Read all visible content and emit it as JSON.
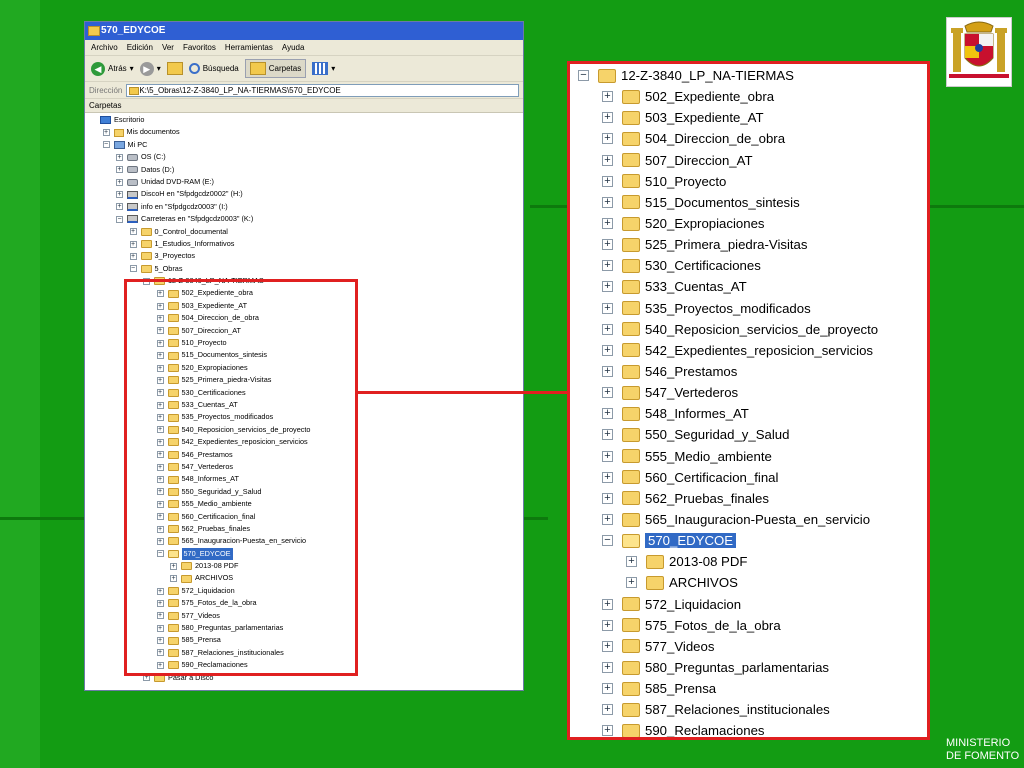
{
  "window": {
    "title": "570_EDYCOE",
    "menu": [
      "Archivo",
      "Edición",
      "Ver",
      "Favoritos",
      "Herramientas",
      "Ayuda"
    ],
    "toolbar": {
      "back": "Atrás",
      "search": "Búsqueda",
      "folders": "Carpetas"
    },
    "address_label": "Dirección",
    "address_value": "K:\\5_Obras\\12-Z-3840_LP_NA-TIERMAS\\570_EDYCOE",
    "folders_pane_title": "Carpetas"
  },
  "tree": [
    {
      "label": "Escritorio",
      "level": 0,
      "icon": "desktop-icon",
      "toggle": "none"
    },
    {
      "label": "Mis documentos",
      "level": 1,
      "icon": "documents-icon",
      "toggle": "plus"
    },
    {
      "label": "Mi PC",
      "level": 1,
      "icon": "computer-icon",
      "toggle": "minus"
    },
    {
      "label": "OS (C:)",
      "level": 2,
      "icon": "drive-icon",
      "toggle": "plus"
    },
    {
      "label": "Datos (D:)",
      "level": 2,
      "icon": "drive-icon",
      "toggle": "plus"
    },
    {
      "label": "Unidad DVD-RAM (E:)",
      "level": 2,
      "icon": "dvd-drive-icon",
      "toggle": "plus"
    },
    {
      "label": "DiscoH en \"Sfpdgcdz0002\" (H:)",
      "level": 2,
      "icon": "network-drive-icon",
      "toggle": "plus"
    },
    {
      "label": "info en \"Sfpdgcdz0003\" (I:)",
      "level": 2,
      "icon": "network-drive-icon",
      "toggle": "plus"
    },
    {
      "label": "Carreteras en \"Sfpdgcdz0003\" (K:)",
      "level": 2,
      "icon": "network-drive-icon",
      "toggle": "minus"
    },
    {
      "label": "0_Control_documental",
      "level": 3,
      "icon": "folder-icon",
      "toggle": "plus"
    },
    {
      "label": "1_Estudios_Informativos",
      "level": 3,
      "icon": "folder-icon",
      "toggle": "plus"
    },
    {
      "label": "3_Proyectos",
      "level": 3,
      "icon": "folder-icon",
      "toggle": "plus"
    },
    {
      "label": "5_Obras",
      "level": 3,
      "icon": "folder-icon",
      "toggle": "minus"
    },
    {
      "label": "12-Z-3840_LP_NA-TIERMAS",
      "level": 4,
      "icon": "folder-icon",
      "toggle": "minus"
    },
    {
      "label": "502_Expediente_obra",
      "level": 5,
      "icon": "folder-icon",
      "toggle": "plus"
    },
    {
      "label": "503_Expediente_AT",
      "level": 5,
      "icon": "folder-icon",
      "toggle": "plus"
    },
    {
      "label": "504_Direccion_de_obra",
      "level": 5,
      "icon": "folder-icon",
      "toggle": "plus"
    },
    {
      "label": "507_Direccion_AT",
      "level": 5,
      "icon": "folder-icon",
      "toggle": "plus"
    },
    {
      "label": "510_Proyecto",
      "level": 5,
      "icon": "folder-icon",
      "toggle": "plus"
    },
    {
      "label": "515_Documentos_sintesis",
      "level": 5,
      "icon": "folder-icon",
      "toggle": "plus"
    },
    {
      "label": "520_Expropiaciones",
      "level": 5,
      "icon": "folder-icon",
      "toggle": "plus"
    },
    {
      "label": "525_Primera_piedra-Visitas",
      "level": 5,
      "icon": "folder-icon",
      "toggle": "plus"
    },
    {
      "label": "530_Certificaciones",
      "level": 5,
      "icon": "folder-icon",
      "toggle": "plus"
    },
    {
      "label": "533_Cuentas_AT",
      "level": 5,
      "icon": "folder-icon",
      "toggle": "plus"
    },
    {
      "label": "535_Proyectos_modificados",
      "level": 5,
      "icon": "folder-icon",
      "toggle": "plus"
    },
    {
      "label": "540_Reposicion_servicios_de_proyecto",
      "level": 5,
      "icon": "folder-icon",
      "toggle": "plus"
    },
    {
      "label": "542_Expedientes_reposicion_servicios",
      "level": 5,
      "icon": "folder-icon",
      "toggle": "plus"
    },
    {
      "label": "546_Prestamos",
      "level": 5,
      "icon": "folder-icon",
      "toggle": "plus"
    },
    {
      "label": "547_Vertederos",
      "level": 5,
      "icon": "folder-icon",
      "toggle": "plus"
    },
    {
      "label": "548_Informes_AT",
      "level": 5,
      "icon": "folder-icon",
      "toggle": "plus"
    },
    {
      "label": "550_Seguridad_y_Salud",
      "level": 5,
      "icon": "folder-icon",
      "toggle": "plus"
    },
    {
      "label": "555_Medio_ambiente",
      "level": 5,
      "icon": "folder-icon",
      "toggle": "plus"
    },
    {
      "label": "560_Certificacion_final",
      "level": 5,
      "icon": "folder-icon",
      "toggle": "plus"
    },
    {
      "label": "562_Pruebas_finales",
      "level": 5,
      "icon": "folder-icon",
      "toggle": "plus"
    },
    {
      "label": "565_Inauguracion-Puesta_en_servicio",
      "level": 5,
      "icon": "folder-icon",
      "toggle": "plus"
    },
    {
      "label": "570_EDYCOE",
      "level": 5,
      "icon": "folder-open-icon",
      "toggle": "minus",
      "selected": true
    },
    {
      "label": "2013-08 PDF",
      "level": 6,
      "icon": "folder-icon",
      "toggle": "plus"
    },
    {
      "label": "ARCHIVOS",
      "level": 6,
      "icon": "folder-icon",
      "toggle": "plus"
    },
    {
      "label": "572_Liquidacion",
      "level": 5,
      "icon": "folder-icon",
      "toggle": "plus"
    },
    {
      "label": "575_Fotos_de_la_obra",
      "level": 5,
      "icon": "folder-icon",
      "toggle": "plus"
    },
    {
      "label": "577_Videos",
      "level": 5,
      "icon": "folder-icon",
      "toggle": "plus"
    },
    {
      "label": "580_Preguntas_parlamentarias",
      "level": 5,
      "icon": "folder-icon",
      "toggle": "plus"
    },
    {
      "label": "585_Prensa",
      "level": 5,
      "icon": "folder-icon",
      "toggle": "plus"
    },
    {
      "label": "587_Relaciones_institucionales",
      "level": 5,
      "icon": "folder-icon",
      "toggle": "plus"
    },
    {
      "label": "590_Reclamaciones",
      "level": 5,
      "icon": "folder-icon",
      "toggle": "plus"
    },
    {
      "label": "Pasar a Disco",
      "level": 4,
      "icon": "folder-icon",
      "toggle": "plus"
    }
  ],
  "zoom_tree": [
    {
      "label": "12-Z-3840_LP_NA-TIERMAS",
      "level": 0,
      "toggle": "minus"
    },
    {
      "label": "502_Expediente_obra",
      "level": 1,
      "toggle": "plus"
    },
    {
      "label": "503_Expediente_AT",
      "level": 1,
      "toggle": "plus"
    },
    {
      "label": "504_Direccion_de_obra",
      "level": 1,
      "toggle": "plus"
    },
    {
      "label": "507_Direccion_AT",
      "level": 1,
      "toggle": "plus"
    },
    {
      "label": "510_Proyecto",
      "level": 1,
      "toggle": "plus"
    },
    {
      "label": "515_Documentos_sintesis",
      "level": 1,
      "toggle": "plus"
    },
    {
      "label": "520_Expropiaciones",
      "level": 1,
      "toggle": "plus"
    },
    {
      "label": "525_Primera_piedra-Visitas",
      "level": 1,
      "toggle": "plus"
    },
    {
      "label": "530_Certificaciones",
      "level": 1,
      "toggle": "plus"
    },
    {
      "label": "533_Cuentas_AT",
      "level": 1,
      "toggle": "plus"
    },
    {
      "label": "535_Proyectos_modificados",
      "level": 1,
      "toggle": "plus"
    },
    {
      "label": "540_Reposicion_servicios_de_proyecto",
      "level": 1,
      "toggle": "plus"
    },
    {
      "label": "542_Expedientes_reposicion_servicios",
      "level": 1,
      "toggle": "plus"
    },
    {
      "label": "546_Prestamos",
      "level": 1,
      "toggle": "plus"
    },
    {
      "label": "547_Vertederos",
      "level": 1,
      "toggle": "plus"
    },
    {
      "label": "548_Informes_AT",
      "level": 1,
      "toggle": "plus"
    },
    {
      "label": "550_Seguridad_y_Salud",
      "level": 1,
      "toggle": "plus"
    },
    {
      "label": "555_Medio_ambiente",
      "level": 1,
      "toggle": "plus"
    },
    {
      "label": "560_Certificacion_final",
      "level": 1,
      "toggle": "plus"
    },
    {
      "label": "562_Pruebas_finales",
      "level": 1,
      "toggle": "plus"
    },
    {
      "label": "565_Inauguracion-Puesta_en_servicio",
      "level": 1,
      "toggle": "plus"
    },
    {
      "label": "570_EDYCOE",
      "level": 1,
      "toggle": "minus",
      "selected": true
    },
    {
      "label": "2013-08 PDF",
      "level": 2,
      "toggle": "plus"
    },
    {
      "label": "ARCHIVOS",
      "level": 2,
      "toggle": "plus"
    },
    {
      "label": "572_Liquidacion",
      "level": 1,
      "toggle": "plus"
    },
    {
      "label": "575_Fotos_de_la_obra",
      "level": 1,
      "toggle": "plus"
    },
    {
      "label": "577_Videos",
      "level": 1,
      "toggle": "plus"
    },
    {
      "label": "580_Preguntas_parlamentarias",
      "level": 1,
      "toggle": "plus"
    },
    {
      "label": "585_Prensa",
      "level": 1,
      "toggle": "plus"
    },
    {
      "label": "587_Relaciones_institucionales",
      "level": 1,
      "toggle": "plus"
    },
    {
      "label": "590_Reclamaciones",
      "level": 1,
      "toggle": "plus"
    }
  ],
  "ministry": {
    "line1": "MINISTERIO",
    "line2": "DE FOMENTO"
  },
  "colors": {
    "background": "#139c13",
    "highlight": "#e02020",
    "selection": "#316ac5"
  }
}
